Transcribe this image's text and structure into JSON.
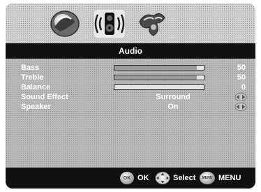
{
  "menu": {
    "tabs": [
      {
        "name": "picture",
        "icon": "picture-icon"
      },
      {
        "name": "audio",
        "icon": "speaker-icon",
        "active": true
      },
      {
        "name": "setup",
        "icon": "setup-icon"
      }
    ],
    "title": "Audio"
  },
  "settings": [
    {
      "label": "Bass",
      "type": "slider",
      "value": "50",
      "level": 0.92
    },
    {
      "label": "Treble",
      "type": "slider",
      "value": "50",
      "level": 0.92
    },
    {
      "label": "Balance",
      "type": "slider",
      "value": "0",
      "level": 0.0
    },
    {
      "label": "Sound Effect",
      "type": "option",
      "value": "Surround"
    },
    {
      "label": "Speaker",
      "type": "option",
      "value": "On"
    }
  ],
  "footer": {
    "ok_icon_text": "OK",
    "ok_label": "OK",
    "select_label": "Select",
    "menu_icon_text": "MENU",
    "menu_label": "MENU"
  },
  "colors": {
    "header_bar": "#111111",
    "panel": "#b9b9b9"
  }
}
